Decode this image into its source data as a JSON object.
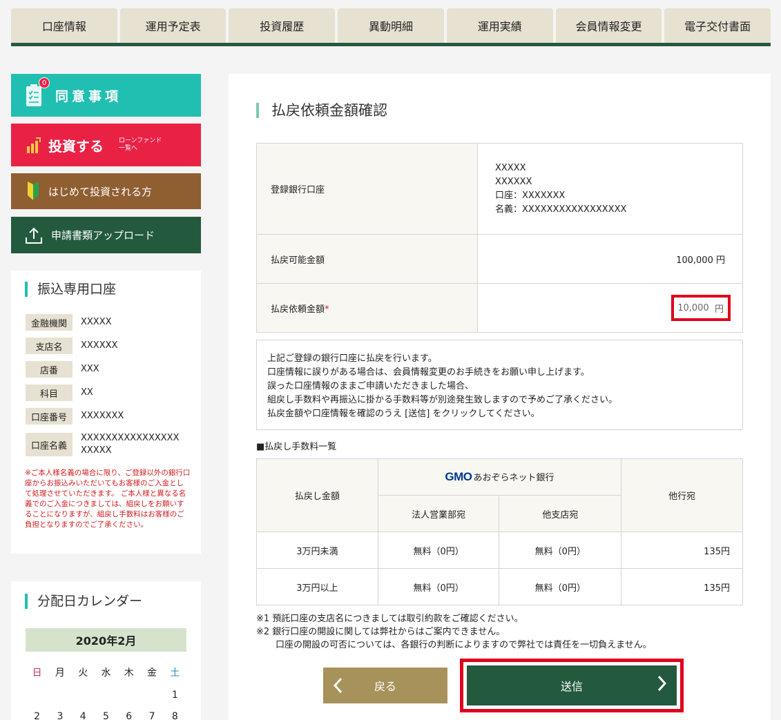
{
  "nav": {
    "tabs": [
      "口座情報",
      "運用予定表",
      "投資履歴",
      "異動明細",
      "運用実績",
      "会員情報変更",
      "電子交付書面"
    ]
  },
  "sidebar": {
    "agree": {
      "label": "同意事項",
      "badge": "0"
    },
    "invest": {
      "label": "投資する",
      "sub1": "ローンファンド",
      "sub2": "一覧へ"
    },
    "first": {
      "label": "はじめて投資される方"
    },
    "upload": {
      "label": "申請書類アップロード"
    }
  },
  "transfer": {
    "title": "振込専用口座",
    "rows": [
      {
        "label": "金融機関",
        "value": "XXXXX"
      },
      {
        "label": "支店名",
        "value": "XXXXXX"
      },
      {
        "label": "店番",
        "value": "XXX"
      },
      {
        "label": "科目",
        "value": "XX"
      },
      {
        "label": "口座番号",
        "value": "XXXXXXX"
      },
      {
        "label": "口座名義",
        "value": "XXXXXXXXXXXXXXXX",
        "value2": "XXXXX"
      }
    ],
    "note": "※ご本人様名義の場合に限り、ご登録以外の銀行口座からお振込みいただいてもお客様のご入金として処理させていただきます。 ご本人様と異なる名義でのご入金につきましては、組戻しをお願いすることになりますが、組戻し手数料はお客様のご負担となりますのでご了承ください。"
  },
  "calendar": {
    "title": "分配日カレンダー",
    "month": "2020年2月",
    "weekdays": [
      "日",
      "月",
      "火",
      "水",
      "木",
      "金",
      "土"
    ],
    "week1": [
      "",
      "",
      "",
      "",
      "",
      "",
      "1"
    ],
    "week2": [
      "2",
      "3",
      "4",
      "5",
      "6",
      "7",
      "8"
    ]
  },
  "main": {
    "title": "払戻依頼金額確認",
    "bank_label": "登録銀行口座",
    "bank_lines": [
      "XXXXX",
      "XXXXXX",
      "口座：XXXXXXX",
      "名義：XXXXXXXXXXXXXXXXX"
    ],
    "available_label": "払戻可能金額",
    "available_value": "100,000 円",
    "request_label": "払戻依頼金額",
    "required_mark": "*",
    "request_value": "10,000",
    "request_unit": "円",
    "message_lines": [
      "上記ご登録の銀行口座に払戻を行います。",
      "口座情報に誤りがある場合は、会員情報変更のお手続きをお願い申し上げます。",
      "誤った口座情報のままご申請いただきました場合、",
      "組戻し手数料や再振込に掛かる手数料等が別途発生致しますので予めご了承ください。",
      "払戻金額や口座情報を確認のうえ [送信] をクリックしてください。"
    ],
    "fee_heading": "■払戻し手数料一覧",
    "fee": {
      "col_amount": "払戻し金額",
      "gmo_logo": "GMO",
      "gmo_bank": "あおぞらネット銀行",
      "col_corp": "法人営業部宛",
      "col_branch": "他支店宛",
      "col_other": "他行宛",
      "rows": [
        {
          "amount": "3万円未満",
          "corp": "無料（0円）",
          "branch": "無料（0円）",
          "other": "135円"
        },
        {
          "amount": "3万円以上",
          "corp": "無料（0円）",
          "branch": "無料（0円）",
          "other": "135円"
        }
      ]
    },
    "footnotes": [
      "※1 預託口座の支店名につきましては取引約款をご確認ください。",
      "※2 銀行口座の開設に関しては弊社からはご案内できません。",
      "口座の開設の可否については、各銀行の判断によりますので弊社では責任を一切負えません。"
    ],
    "back_label": "戻る",
    "send_label": "送信"
  }
}
